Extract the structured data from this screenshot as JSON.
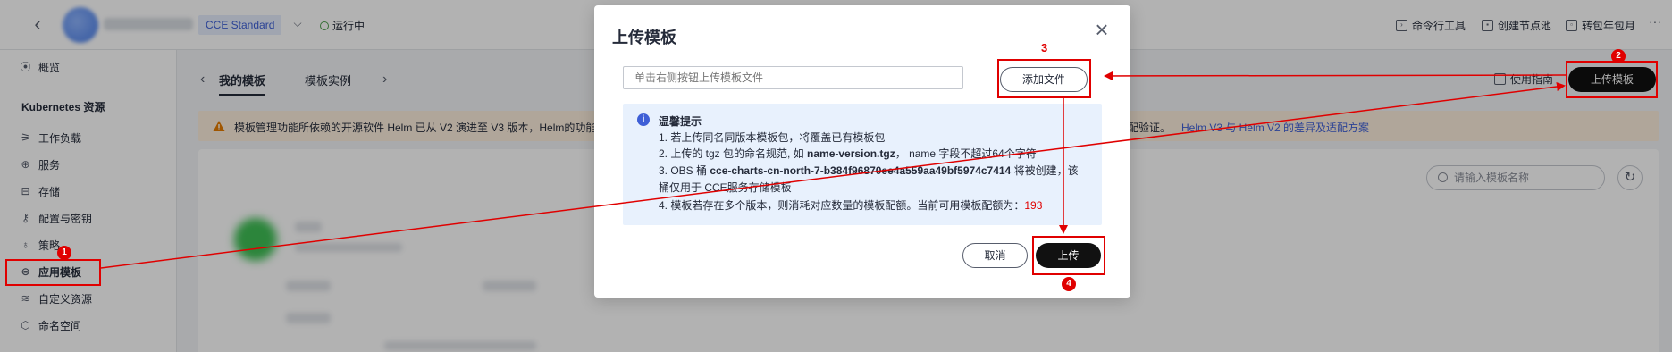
{
  "header": {
    "edition": "CCE Standard",
    "status": "运行中",
    "toolbar": [
      {
        "label": "命令行工具",
        "icon": "terminal-icon"
      },
      {
        "label": "创建节点池",
        "icon": "node-pool-icon"
      },
      {
        "label": "转包年包月",
        "icon": "calendar-icon"
      }
    ],
    "more": "···"
  },
  "sidebar": {
    "overview": "概览",
    "section": "Kubernetes 资源",
    "items": [
      {
        "label": "工作负载"
      },
      {
        "label": "服务"
      },
      {
        "label": "存储"
      },
      {
        "label": "配置与密钥"
      },
      {
        "label": "策略"
      },
      {
        "label": "应用模板"
      },
      {
        "label": "自定义资源"
      },
      {
        "label": "命名空间"
      }
    ]
  },
  "main": {
    "tabs": [
      "我的模板",
      "模板实例"
    ],
    "usage_guide": "使用指南",
    "upload_template": "上传模板",
    "notice_left": "模板管理功能所依赖的开源软件 Helm 已从 V2 演进至 V3 版本，Helm的功能",
    "notice_right": "配验证。",
    "notice_link": "Helm V3 与 Helm V2 的差异及适配方案",
    "search_placeholder": "请输入模板名称"
  },
  "modal": {
    "title": "上传模板",
    "file_placeholder": "单击右侧按钮上传模板文件",
    "add_file": "添加文件",
    "tip_title": "温馨提示",
    "tips": {
      "t1": "1. 若上传同名同版本模板包，将覆盖已有模板包",
      "t2_pre": "2. 上传的 tgz 包的命名规范, 如 ",
      "t2_bold": "name-version.tgz",
      "t2_post": "， name 字段不超过64个字符",
      "t3_pre": "3. OBS 桶 ",
      "t3_bold": "cce-charts-cn-north-7-b384f96870ee4a559aa49bf5974c7414",
      "t3_post": " 将被创建，该",
      "t3_cont": "桶仅用于 CCE服务存储模板",
      "t4_pre": "4. 模板若存在多个版本，则消耗对应数量的模板配额。当前可用模板配额为：",
      "t4_quota": "193"
    },
    "cancel": "取消",
    "upload": "上传"
  },
  "annotations": {
    "steps": [
      "1",
      "2",
      "3",
      "4"
    ],
    "color": "#e00000"
  }
}
